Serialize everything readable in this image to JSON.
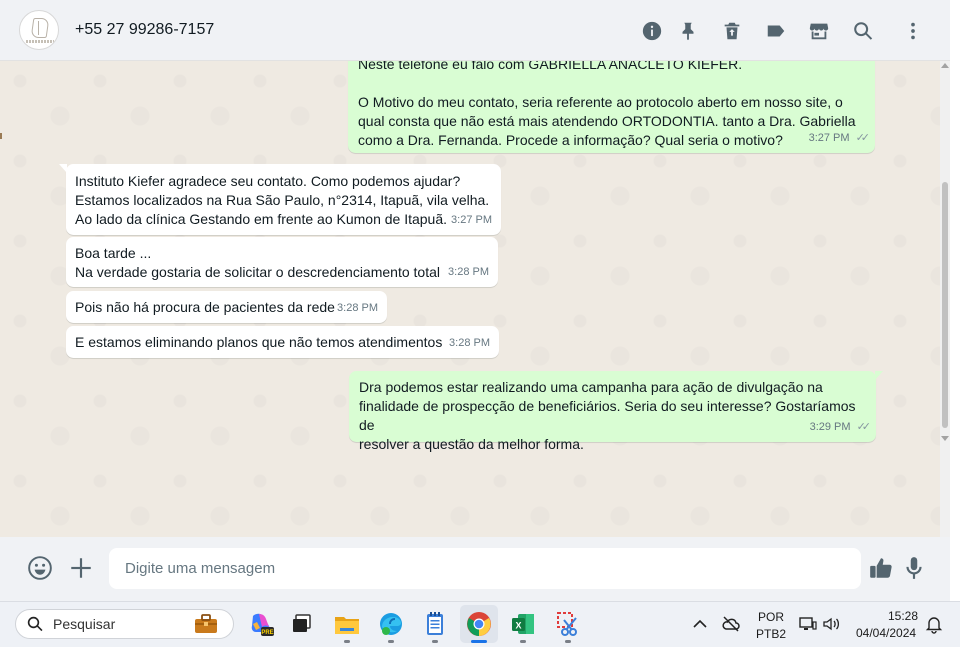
{
  "header": {
    "contact_name": "+55 27 99286-7157",
    "icons": [
      "info-icon",
      "pin-icon",
      "delete-icon",
      "label-icon",
      "store-icon",
      "search-icon",
      "menu-icon"
    ]
  },
  "messages": [
    {
      "direction": "out",
      "text_partial_top": "Neste telefone eu falo com GABRIELLA ANACLETO KIEFER.",
      "text": "O Motivo do meu contato, seria referente ao protocolo aberto em nosso site, o\nqual consta que não está mais atendendo ORTODONTIA. tanto a Dra. Gabriella\ncomo a Dra. Fernanda. Procede a informação? Qual seria o motivo?",
      "time": "3:27 PM",
      "ticks": "✓✓"
    },
    {
      "direction": "in",
      "text": "Instituto Kiefer agradece seu contato. Como podemos ajudar?\nEstamos localizados na Rua São Paulo, n°2314, Itapuã, vila velha.\nAo lado da clínica Gestando em frente ao Kumon de Itapuã.",
      "time": "3:27 PM"
    },
    {
      "direction": "in",
      "text": "Boa tarde ...\nNa verdade gostaria de solicitar o descredenciamento total",
      "time": "3:28 PM"
    },
    {
      "direction": "in",
      "text": "Pois não há procura de pacientes da rede",
      "time": "3:28 PM"
    },
    {
      "direction": "in",
      "text": "E estamos eliminando planos que não temos atendimentos",
      "time": "3:28 PM"
    },
    {
      "direction": "out",
      "text": "Dra podemos estar realizando uma campanha para ação de divulgação na\nfinalidade de prospecção de beneficiários. Seria do seu interesse? Gostaríamos de\nresolver a questão da melhor forma.",
      "time": "3:29 PM",
      "ticks": "✓✓"
    }
  ],
  "composer": {
    "placeholder": "Digite uma mensagem",
    "icons": [
      "emoji-icon",
      "attach-plus-icon",
      "thumbs-up-icon",
      "microphone-icon"
    ]
  },
  "taskbar": {
    "search_label": "Pesquisar",
    "apps": [
      "copilot-icon",
      "task-view-icon",
      "file-explorer-icon",
      "edge-icon",
      "notepad-icon",
      "chrome-icon",
      "excel-icon",
      "snipping-tool-icon"
    ],
    "language_line1": "POR",
    "language_line2": "PTB2",
    "time": "15:28",
    "date": "04/04/2024"
  },
  "colors": {
    "outgoing_bubble": "#d9fdd3",
    "incoming_bubble": "#ffffff",
    "chat_background": "#efeae2",
    "header_background": "#f0f2f5",
    "icon_gray": "#54656f"
  }
}
